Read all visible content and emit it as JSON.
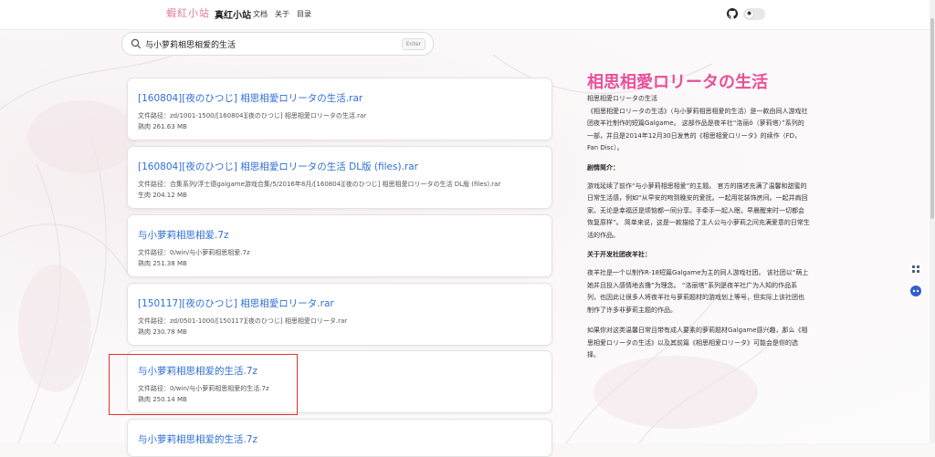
{
  "header": {
    "logo_text": "蝦紅小站",
    "site_title": "真红小站",
    "nav": [
      "文档",
      "关于",
      "目录"
    ],
    "github_icon": "github-icon",
    "theme_icon": "sun-icon"
  },
  "search": {
    "value": "与小萝莉相思相爱的生活",
    "enter_label": "Enter",
    "icon": "search-icon"
  },
  "results": [
    {
      "title": "[160804][夜のひつじ] 相思相愛ロリータの生活.rar",
      "path": "文件路径：zd/1001-1500/[160804][夜のひつじ] 相思相愛ロリータの生活.rar",
      "size": "熟肉  261.63 MB"
    },
    {
      "title": "[160804][夜のひつじ] 相思相愛ロリータの生活 DL版 (files).rar",
      "path": "文件路径：合集系列/浮士德galgame游戏合集/5/2016年8月/[160804][夜のひつじ] 相思相愛ロリータの生活 DL版 (files).rar",
      "size": "生肉  204.12 MB"
    },
    {
      "title": "与小萝莉相思相爱.7z",
      "path": "文件路径：0/win/与小萝莉相思相爱.7z",
      "size": "熟肉  251.38 MB"
    },
    {
      "title": "[150117][夜のひつじ] 相思相愛ロリータ.rar",
      "path": "文件路径：zd/0501-1000/[150117][夜のひつじ] 相思相愛ロリータ.rar",
      "size": "熟肉  230.78 MB"
    },
    {
      "title": "与小萝莉相思相爱的生活.7z",
      "path": "文件路径：0/win/与小萝莉相思相爱的生活.7z",
      "size": "熟肉  250.14 MB"
    },
    {
      "title": "与小萝莉相思相爱的生活.7z",
      "path": "",
      "size": ""
    }
  ],
  "info": {
    "title": "相思相愛ロリータの生活",
    "intro1": "相思相愛ロリータの生活",
    "intro2": "《相思相愛ロリータの生活》（与小萝莉相思相爱的生活）是一款由同人游戏社团夜羊社制作的短篇Galgame。 这部作品是夜羊社“洛丽ô（萝莉塔）”系列的一部，并且是2014年12月30日发售的《相思相爱ロリータ》的续作（FD，Fan Disc）。",
    "plot_heading": "剧情简介：",
    "plot": "游戏延续了前作“与小萝莉相思相爱”的主题。 官方的描述充满了温馨和甜蜜的日常生活感，例如“从早安的吻到晚安的爱抚。一起用花装饰房间。一起并肩回家。无论是幸福还是烦恼都一同分享。手牵手一起入眠，早晨醒来时一切都会恢复原样”。 简单来说，这是一款描绘了主人公与小萝莉之间充满爱意的日常生活的作品。",
    "dev_heading": "关于开发社团夜羊社：",
    "dev": "夜羊社是一个以制作R-18短篇Galgame为主的同人游戏社团。 该社团以“萌上她并且投入感情地去撸”为理念。 “洛丽塔”系列是夜羊社广为人知的作品系列，也因此让很多人将夜羊社与萝莉题材的游戏划上等号，但实际上该社团也制作了许多非萝莉主题的作品。",
    "closing": "如果你对这类温馨日常且带有成人要素的萝莉题材Galgame感兴趣，那么《相思相爱ロリータの生活》以及其前篇《相思相爱ロリータ》可能会是你的选择。"
  },
  "floating": [
    "settings-icon",
    "robot-icon"
  ]
}
